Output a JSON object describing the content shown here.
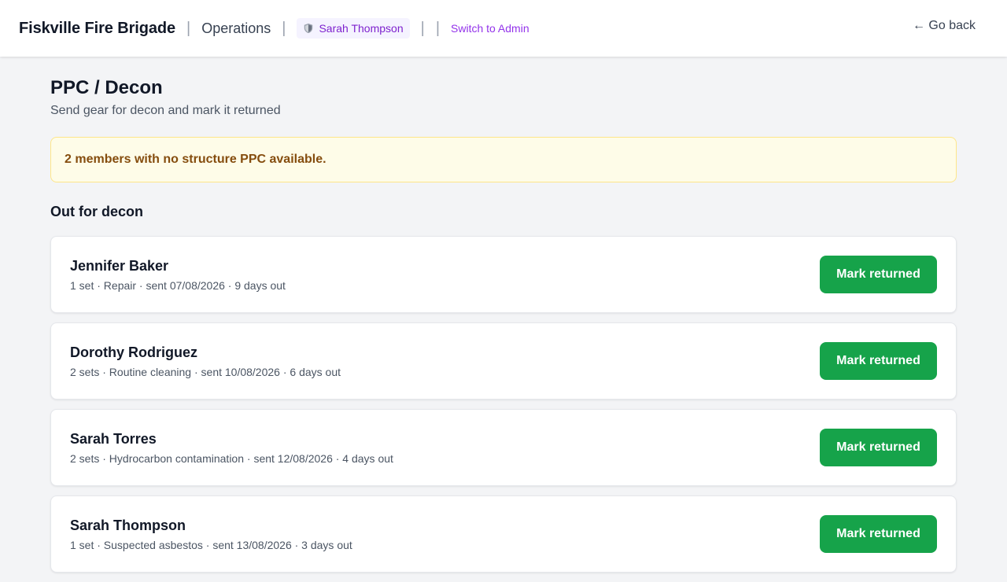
{
  "header": {
    "brand": "Fiskville Fire Brigade",
    "section": "Operations",
    "user_name": "Sarah Thompson",
    "user_icon": "shield-icon",
    "switch_label": "Switch to Admin",
    "go_back_label": "← Go back"
  },
  "page": {
    "title": "PPC / Decon",
    "subtitle": "Send gear for decon and mark it returned"
  },
  "alert": {
    "text": "2 members with no structure PPC available."
  },
  "decon_list": {
    "heading": "Out for decon",
    "items": [
      {
        "name": "Jennifer Baker",
        "meta": "1 set · Repair · sent 07/08/2026 · 9 days out",
        "action": "Mark returned"
      },
      {
        "name": "Dorothy Rodriguez",
        "meta": "2 sets · Routine cleaning · sent 10/08/2026 · 6 days out",
        "action": "Mark returned"
      },
      {
        "name": "Sarah Torres",
        "meta": "2 sets · Hydrocarbon contamination · sent 12/08/2026 · 4 days out",
        "action": "Mark returned"
      },
      {
        "name": "Sarah Thompson",
        "meta": "1 set · Suspected asbestos · sent 13/08/2026 · 3 days out",
        "action": "Mark returned"
      }
    ]
  },
  "colors": {
    "accent_purple": "#9333ea",
    "success_green": "#16a34a",
    "alert_bg": "#fefce8",
    "alert_text": "#854d0e"
  }
}
